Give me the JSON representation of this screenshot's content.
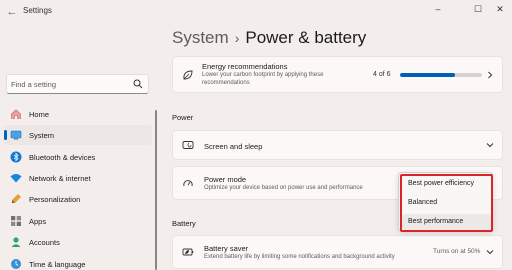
{
  "window": {
    "title": "Settings",
    "back_icon": "back-arrow-icon",
    "controls": {
      "minimize": "–",
      "maximize": "☐",
      "close": "✕"
    }
  },
  "search": {
    "placeholder": "Find a setting",
    "value": ""
  },
  "sidebar": {
    "items": [
      {
        "label": "Home",
        "icon": "home-icon",
        "active": false
      },
      {
        "label": "System",
        "icon": "system-icon",
        "active": true
      },
      {
        "label": "Bluetooth & devices",
        "icon": "bluetooth-icon",
        "active": false
      },
      {
        "label": "Network & internet",
        "icon": "wifi-icon",
        "active": false
      },
      {
        "label": "Personalization",
        "icon": "brush-icon",
        "active": false
      },
      {
        "label": "Apps",
        "icon": "apps-icon",
        "active": false
      },
      {
        "label": "Accounts",
        "icon": "accounts-icon",
        "active": false
      },
      {
        "label": "Time & language",
        "icon": "time-language-icon",
        "active": false
      }
    ]
  },
  "breadcrumb": {
    "parent": "System",
    "separator": "›",
    "current": "Power & battery"
  },
  "energy": {
    "title": "Energy recommendations",
    "subtitle": "Lower your carbon footprint by applying these recommendations",
    "progress_label": "4 of 6",
    "progress_fraction": 0.6667
  },
  "sections": {
    "power": "Power",
    "battery": "Battery"
  },
  "screen_sleep": {
    "title": "Screen and sleep"
  },
  "power_mode": {
    "title": "Power mode",
    "subtitle": "Optimize your device based on power use and performance",
    "options": [
      "Best power efficiency",
      "Balanced",
      "Best performance"
    ]
  },
  "battery_saver": {
    "title": "Battery saver",
    "subtitle": "Extend battery life by limiting some notifications and background activity",
    "status": "Turns on at 50%"
  },
  "colors": {
    "accent": "#0067c0",
    "highlight": "#d9242c",
    "background": "#f3eeec"
  }
}
